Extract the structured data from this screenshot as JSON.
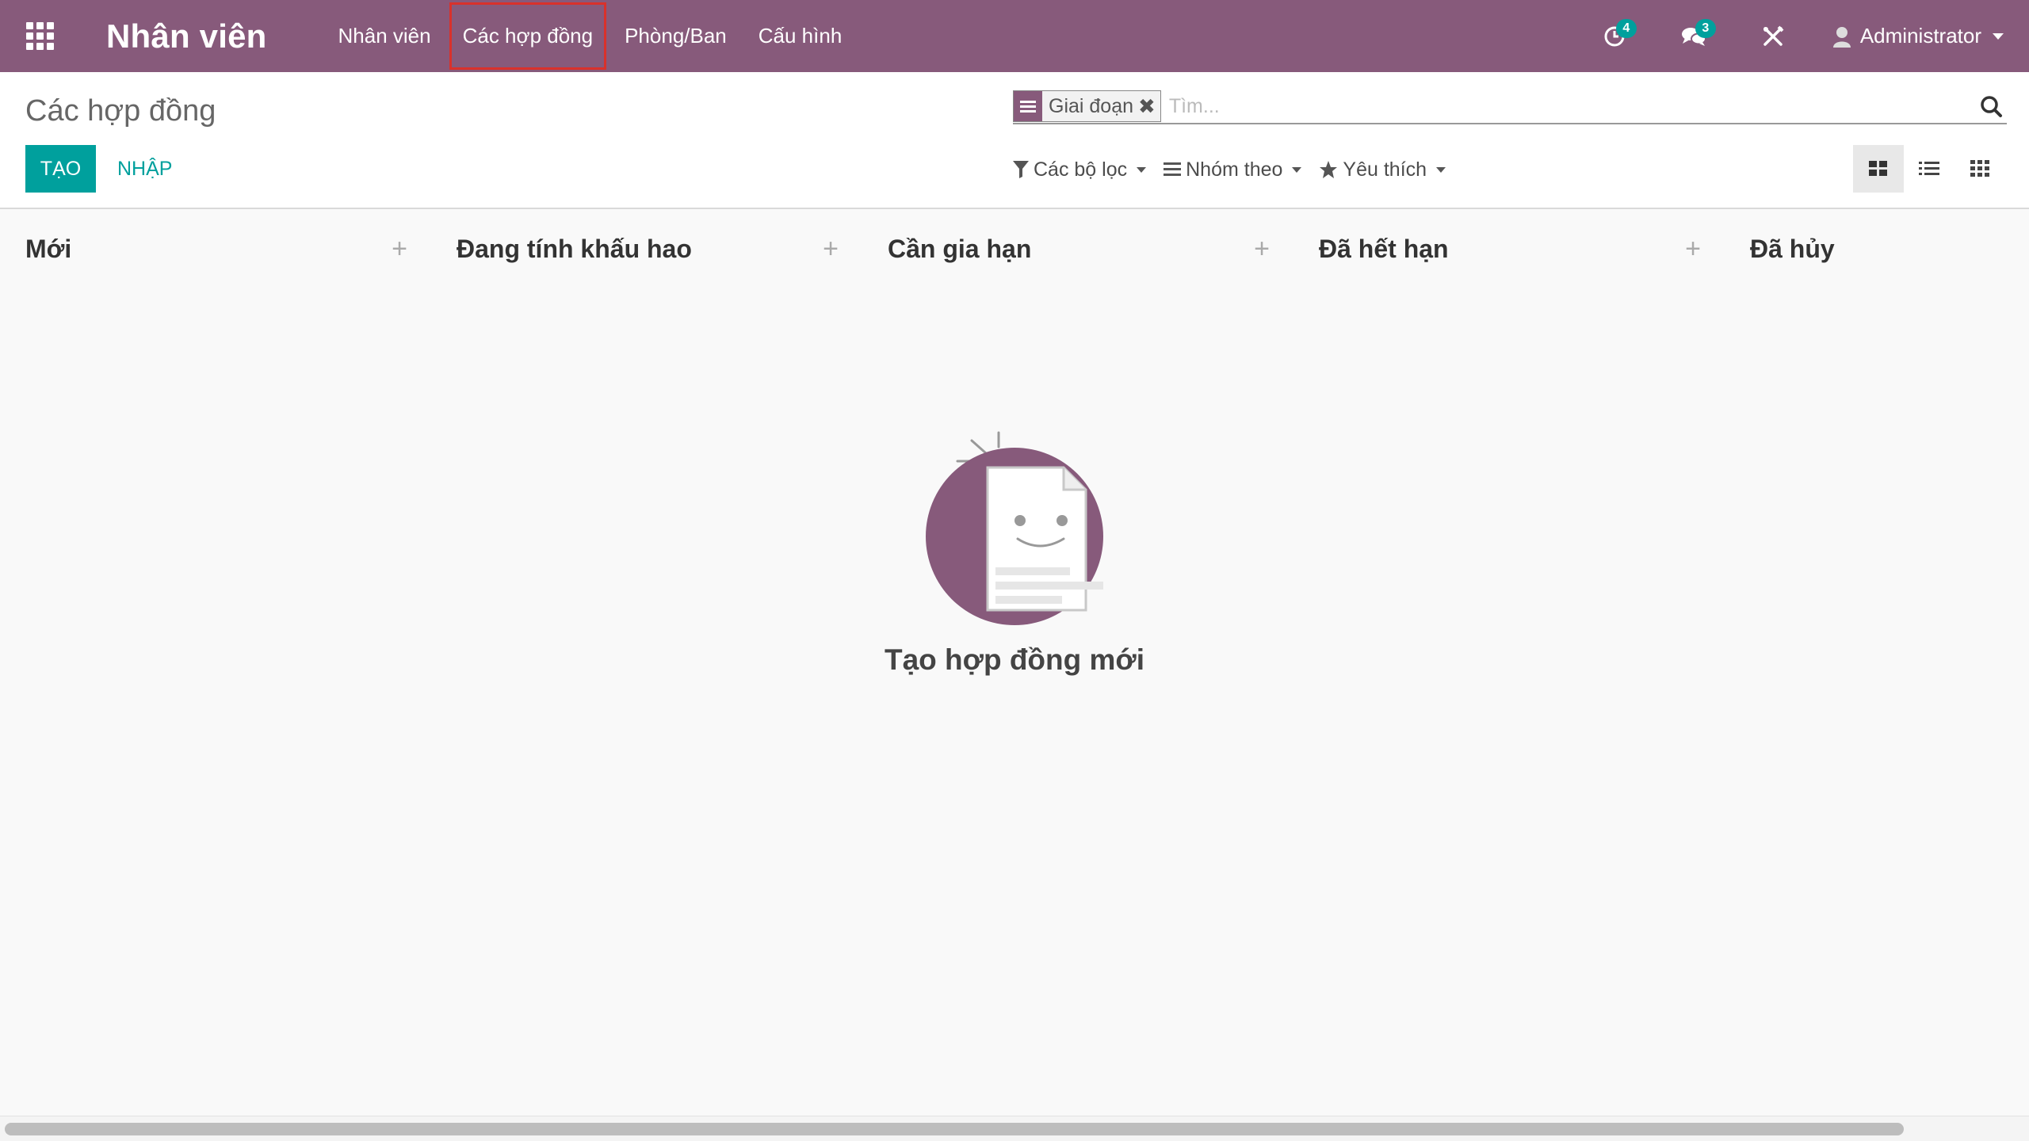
{
  "navbar": {
    "app_title": "Nhân viên",
    "menu": [
      "Nhân viên",
      "Các hợp đồng",
      "Phòng/Ban",
      "Cấu hình"
    ],
    "activity_badge": "4",
    "messages_badge": "3",
    "user_name": "Administrator",
    "color": "#875a7b",
    "badge_color": "#00a09d"
  },
  "control_panel": {
    "breadcrumb": "Các hợp đồng",
    "create_label": "TẠO",
    "import_label": "NHẬP",
    "search": {
      "facet_value": "Giai đoạn",
      "facet_remove": "✖",
      "placeholder": "Tìm..."
    },
    "filters_label": "Các bộ lọc",
    "groupby_label": "Nhóm theo",
    "favorites_label": "Yêu thích",
    "active_view": "kanban"
  },
  "kanban": {
    "columns": [
      {
        "title": "Mới"
      },
      {
        "title": "Đang tính khấu hao"
      },
      {
        "title": "Cần gia hạn"
      },
      {
        "title": "Đã hết hạn"
      },
      {
        "title": "Đã hủy"
      }
    ],
    "add_symbol": "+",
    "helper_title": "Tạo hợp đồng mới"
  }
}
